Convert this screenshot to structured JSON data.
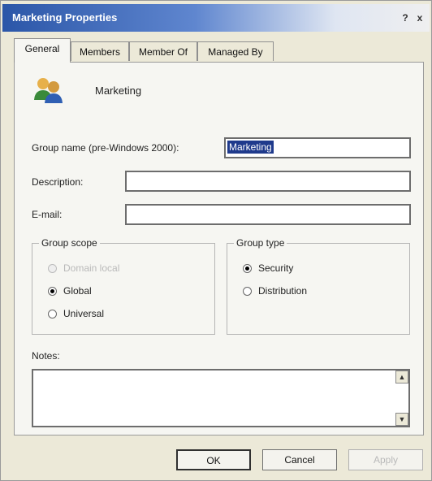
{
  "window": {
    "title": "Marketing Properties",
    "help_glyph": "?",
    "close_glyph": "x"
  },
  "tabs": [
    "General",
    "Members",
    "Member Of",
    "Managed By"
  ],
  "general": {
    "group_display_name": "Marketing",
    "icon": "group-users-icon",
    "prewin_label": "Group name (pre-Windows 2000):",
    "prewin_value": "Marketing",
    "description_label": "Description:",
    "description_value": "",
    "email_label": "E-mail:",
    "email_value": "",
    "scope": {
      "label": "Group scope",
      "options": [
        {
          "label": "Domain local",
          "selected": false,
          "enabled": false
        },
        {
          "label": "Global",
          "selected": true,
          "enabled": true
        },
        {
          "label": "Universal",
          "selected": false,
          "enabled": true
        }
      ]
    },
    "type": {
      "label": "Group type",
      "options": [
        {
          "label": "Security",
          "selected": true,
          "enabled": true
        },
        {
          "label": "Distribution",
          "selected": false,
          "enabled": true
        }
      ]
    },
    "notes_label": "Notes:",
    "notes_value": ""
  },
  "buttons": {
    "ok": "OK",
    "cancel": "Cancel",
    "apply": "Apply"
  },
  "colors": {
    "title_bar": "#2b56a8",
    "selection": "#1f3a8c",
    "dialog_bg": "#ece9d8"
  }
}
